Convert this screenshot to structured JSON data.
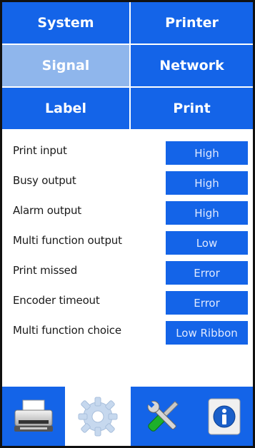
{
  "tabs": [
    {
      "label": "System",
      "active": false
    },
    {
      "label": "Printer",
      "active": false
    },
    {
      "label": "Signal",
      "active": true
    },
    {
      "label": "Network",
      "active": false
    },
    {
      "label": "Label",
      "active": false
    },
    {
      "label": "Print",
      "active": false
    }
  ],
  "settings": [
    {
      "label": "Print input",
      "value": "High"
    },
    {
      "label": "Busy output",
      "value": "High"
    },
    {
      "label": "Alarm output",
      "value": "High"
    },
    {
      "label": "Multi function output",
      "value": "Low"
    },
    {
      "label": "Print missed",
      "value": "Error"
    },
    {
      "label": "Encoder timeout",
      "value": "Error"
    },
    {
      "label": "Multi function choice",
      "value": "Low Ribbon"
    }
  ],
  "toolbar": {
    "items": [
      {
        "icon": "printer-icon",
        "selected": false
      },
      {
        "icon": "gear-icon",
        "selected": true
      },
      {
        "icon": "tools-icon",
        "selected": false
      },
      {
        "icon": "info-icon",
        "selected": false
      }
    ]
  },
  "colors": {
    "accent": "#1464e8",
    "accent_active": "#8fb6ec",
    "background": "#ffffff"
  }
}
